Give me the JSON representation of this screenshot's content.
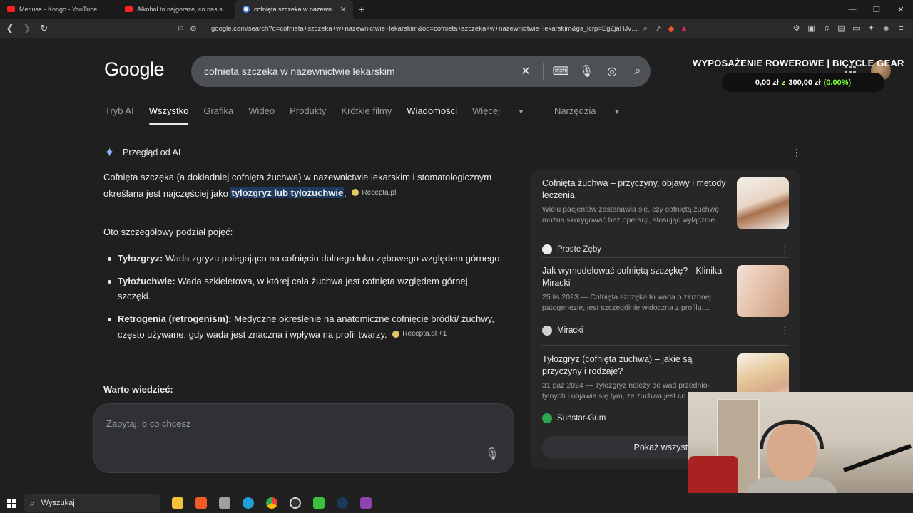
{
  "browser": {
    "tabs": [
      {
        "title": "Medusa - Kongo - YouTube",
        "favicon": "youtube-icon"
      },
      {
        "title": "Alkohol to najgorsze, co nas spotkało",
        "favicon": "youtube-icon"
      },
      {
        "title": "cofnięta szczeka w nazewnictwie",
        "favicon": "google-icon",
        "active": true
      }
    ],
    "new_tab": "+",
    "url": "google.com/search?q=cofnieta+szczeka+w+nazewnictwie+lekarskim&oq=cofnieta+szczeka+w+nazewnictwie+lekarskim&gs_lcrp=EgZjaHJvb..."
  },
  "google": {
    "logo": "Google",
    "query": "cofnieta szczeka w nazewnictwie lekarskim",
    "nav": {
      "ai": "Tryb AI",
      "all": "Wszystko",
      "images": "Grafika",
      "video": "Wideo",
      "products": "Produkty",
      "shorts": "Krótkie filmy",
      "news": "Wiadomości",
      "more": "Więcej",
      "tools": "Narzędzia"
    }
  },
  "overlay": {
    "title": "WYPOSAŻENIE ROWEROWE | BICYCLE GEAR",
    "current": "0,00 zł",
    "z": "z",
    "goal": "300,00 zł",
    "percent": "(0.00%)"
  },
  "ai_overview": {
    "heading": "Przegląd od AI",
    "intro_before": "Cofnięta szczęka (a dokładniej cofnięta żuchwa) w nazewnictwie lekarskim i stomatologicznym określana jest najczęściej jako ",
    "intro_hl": "tyłozgryz lub tyłożuchwie",
    "intro_after": ".",
    "intro_source": "Recepta.pl",
    "detail_intro": "Oto szczegółowy podział pojęć:",
    "items": [
      {
        "term": "Tyłozgryz:",
        "text": " Wada zgryzu polegająca na cofnięciu dolnego łuku zębowego względem górnego."
      },
      {
        "term": "Tyłożuchwie:",
        "text": " Wada szkieletowa, w której cała żuchwa jest cofnięta względem górnej szczęki."
      },
      {
        "term": "Retrogenia (retrogenism):",
        "text": " Medyczne określenie na anatomiczne cofnięcie bródki/ żuchwy, często używane, gdy wada jest znaczna i wpływa na profil twarzy.",
        "source": "Recepta.pl +1"
      }
    ],
    "warto": "Warto wiedzieć:",
    "ask_placeholder": "Zapytaj, o co chcesz"
  },
  "sources": [
    {
      "title": "Cofnięta żuchwa – przyczyny, objawy i metody leczenia",
      "snippet": "Wielu pacjentów zastanawia się, czy cofniętą żuchwę można skorygować bez operacji, stosując wyłącznie...",
      "site": "Proste Zęby"
    },
    {
      "title": "Jak wymodelować cofniętą szczękę? - Klinika Miracki",
      "snippet": "25 lis 2023 — Cofnięta szczęka to wada o złożonej patogenezie, jest szczególnie widoczna z profilu....",
      "site": "Miracki"
    },
    {
      "title": "Tyłozgryz (cofnięta żuchwa) – jakie są przyczyny i rodzaje?",
      "snippet": "31 paź 2024 — Tyłozgryz należy do wad przednio-tylnych i objawia się tym, że żuchwa jest co...",
      "site": "Sunstar-Gum"
    }
  ],
  "show_all": "Pokaż wszystko",
  "taskbar": {
    "search": "Wyszukaj"
  }
}
